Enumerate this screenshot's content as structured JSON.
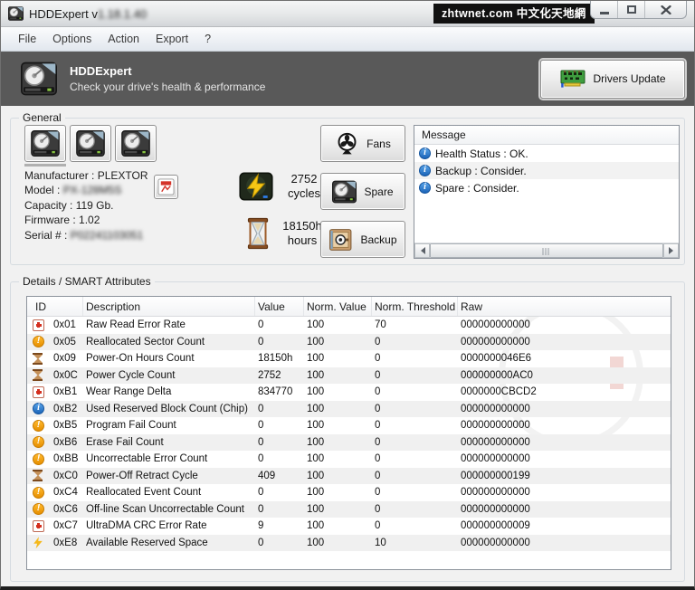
{
  "window": {
    "title_prefix": "HDDExpert v",
    "title_version": "1.18.1.40",
    "badge": "zhtwnet.com 中文化天地網"
  },
  "menu": {
    "items": [
      "File",
      "Options",
      "Action",
      "Export",
      "?"
    ]
  },
  "header": {
    "app_name": "HDDExpert",
    "tagline": "Check your drive's health & performance",
    "drivers_update_label": "Drivers Update"
  },
  "general": {
    "group_label": "General",
    "info": {
      "manufacturer_label": "Manufacturer :",
      "manufacturer_value": "PLEXTOR",
      "model_label": "Model :",
      "model_value": "PX-128M5S",
      "capacity_label": "Capacity :",
      "capacity_value": "119 Gb.",
      "firmware_label": "Firmware :",
      "firmware_value": "1.02",
      "serial_label": "Serial # :",
      "serial_value": "P02241103051"
    },
    "stats": {
      "cycles": {
        "value": "2752",
        "unit": "cycles"
      },
      "hours": {
        "value": "18150h",
        "unit": "hours"
      }
    },
    "buttons": {
      "fans": "Fans",
      "spare": "Spare",
      "backup": "Backup"
    }
  },
  "message_panel": {
    "title": "Message",
    "items": [
      "Health Status : OK.",
      "Backup : Consider.",
      "Spare : Consider."
    ]
  },
  "smart": {
    "group_label": "Details / SMART Attributes",
    "columns": [
      "ID",
      "Description",
      "Value",
      "Norm. Value",
      "Norm. Threshold",
      "Raw"
    ],
    "rows": [
      {
        "icon": "medical-cross",
        "id": "0x01",
        "description": "Raw Read Error Rate",
        "value": "0",
        "norm_value": "100",
        "norm_threshold": "70",
        "raw": "000000000000"
      },
      {
        "icon": "warning",
        "id": "0x05",
        "description": "Reallocated Sector Count",
        "value": "0",
        "norm_value": "100",
        "norm_threshold": "0",
        "raw": "000000000000"
      },
      {
        "icon": "hourglass",
        "id": "0x09",
        "description": "Power-On Hours Count",
        "value": "18150h",
        "norm_value": "100",
        "norm_threshold": "0",
        "raw": "0000000046E6"
      },
      {
        "icon": "hourglass",
        "id": "0x0C",
        "description": "Power Cycle Count",
        "value": "2752",
        "norm_value": "100",
        "norm_threshold": "0",
        "raw": "000000000AC0"
      },
      {
        "icon": "medical-cross",
        "id": "0xB1",
        "description": "Wear Range Delta",
        "value": "834770",
        "norm_value": "100",
        "norm_threshold": "0",
        "raw": "0000000CBCD2"
      },
      {
        "icon": "info",
        "id": "0xB2",
        "description": "Used Reserved Block Count (Chip)",
        "value": "0",
        "norm_value": "100",
        "norm_threshold": "0",
        "raw": "000000000000"
      },
      {
        "icon": "warning",
        "id": "0xB5",
        "description": "Program Fail Count",
        "value": "0",
        "norm_value": "100",
        "norm_threshold": "0",
        "raw": "000000000000"
      },
      {
        "icon": "warning",
        "id": "0xB6",
        "description": "Erase Fail Count",
        "value": "0",
        "norm_value": "100",
        "norm_threshold": "0",
        "raw": "000000000000"
      },
      {
        "icon": "warning",
        "id": "0xBB",
        "description": "Uncorrectable Error Count",
        "value": "0",
        "norm_value": "100",
        "norm_threshold": "0",
        "raw": "000000000000"
      },
      {
        "icon": "hourglass",
        "id": "0xC0",
        "description": "Power-Off Retract Cycle",
        "value": "409",
        "norm_value": "100",
        "norm_threshold": "0",
        "raw": "000000000199"
      },
      {
        "icon": "warning",
        "id": "0xC4",
        "description": "Reallocated Event Count",
        "value": "0",
        "norm_value": "100",
        "norm_threshold": "0",
        "raw": "000000000000"
      },
      {
        "icon": "warning",
        "id": "0xC6",
        "description": "Off-line Scan Uncorrectable Count",
        "value": "0",
        "norm_value": "100",
        "norm_threshold": "0",
        "raw": "000000000000"
      },
      {
        "icon": "medical-cross",
        "id": "0xC7",
        "description": "UltraDMA CRC Error Rate",
        "value": "9",
        "norm_value": "100",
        "norm_threshold": "0",
        "raw": "000000000009"
      },
      {
        "icon": "lightning",
        "id": "0xE8",
        "description": "Available Reserved Space",
        "value": "0",
        "norm_value": "100",
        "norm_threshold": "10",
        "raw": "000000000000"
      }
    ]
  },
  "colors": {
    "band_bg": "#595959",
    "info_blue": "#1b64b8",
    "warning_orange": "#e68f00",
    "error_red": "#d42f1f",
    "lightning_yellow": "#f5b91d",
    "badge_bg": "#111111"
  }
}
